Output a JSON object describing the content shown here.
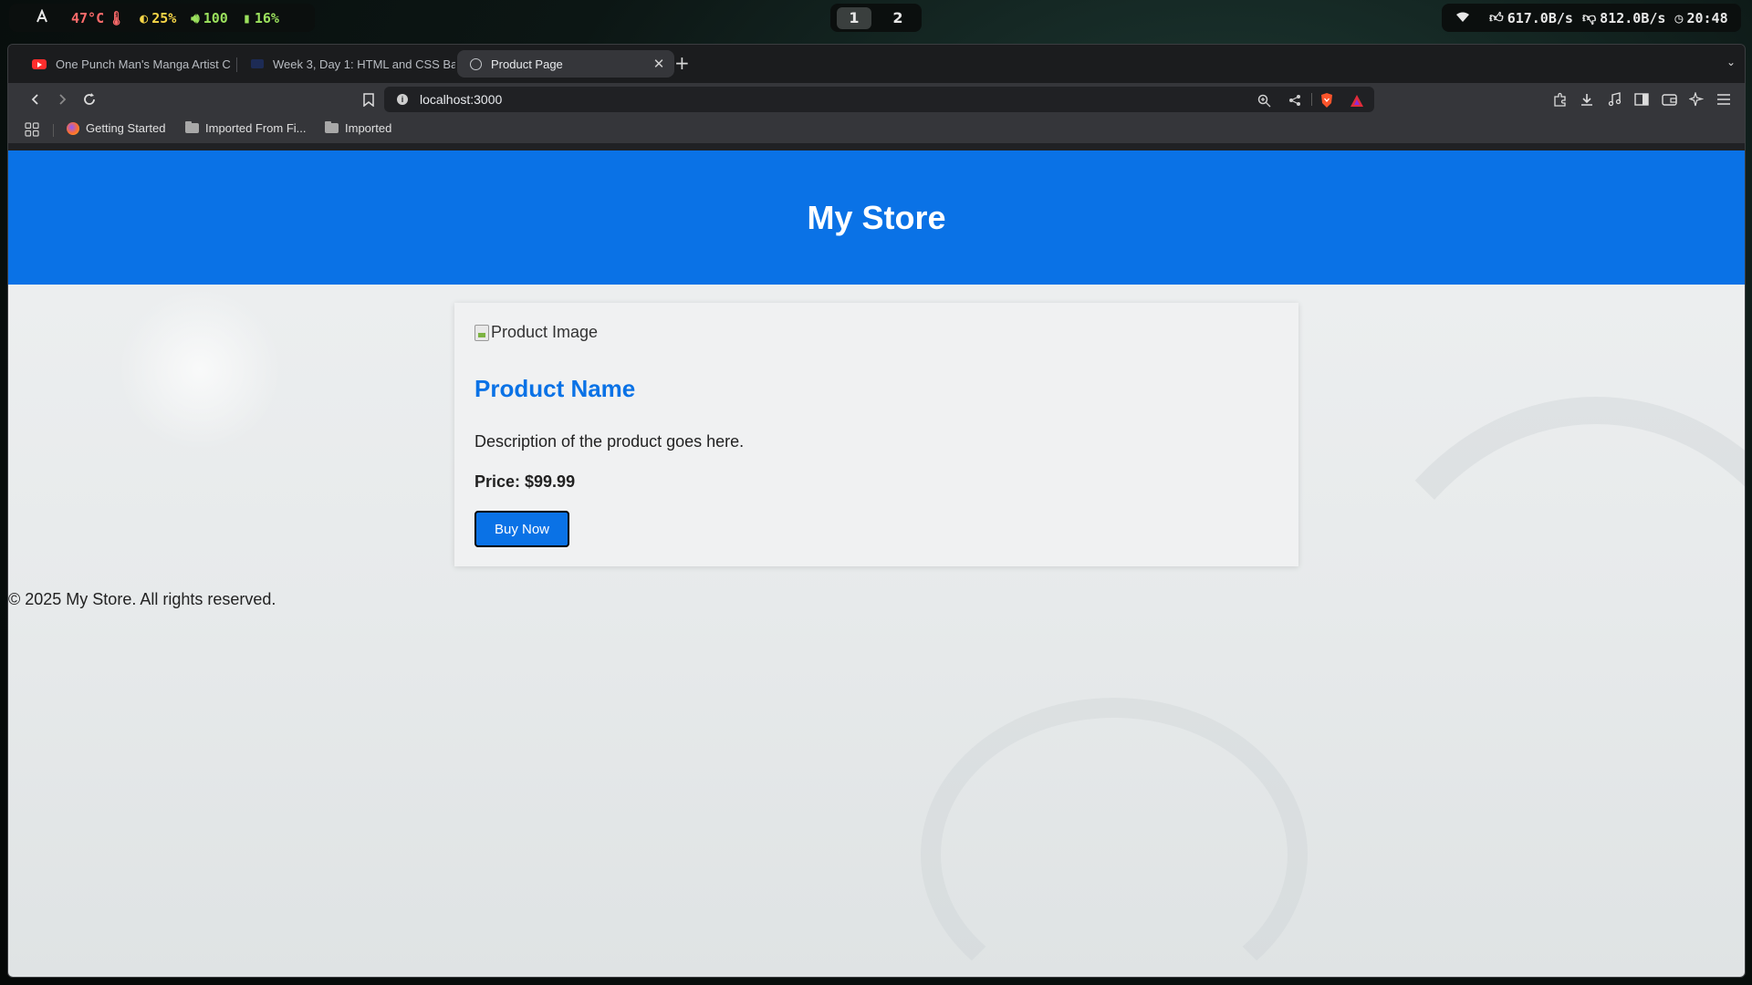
{
  "system_bar": {
    "temperature": "47°C",
    "brightness": "25%",
    "volume": "100",
    "battery": "16%",
    "workspaces": [
      "1",
      "2"
    ],
    "active_workspace": "1",
    "upload_speed": "617.0B/s",
    "download_speed": "812.0B/s",
    "clock": "20:48"
  },
  "browser": {
    "tabs": [
      {
        "title": "One Punch Man's Manga Artist C",
        "favicon": "youtube-icon",
        "active": false
      },
      {
        "title": "Week 3, Day 1: HTML and CSS Ba",
        "favicon": "doc-icon",
        "active": false
      },
      {
        "title": "Product Page",
        "favicon": "globe-icon",
        "active": true
      }
    ],
    "url": "localhost:3000",
    "bookmarks": [
      {
        "label": "Getting Started",
        "icon": "firefox-icon"
      },
      {
        "label": "Imported From Fi...",
        "icon": "folder-icon"
      },
      {
        "label": "Imported",
        "icon": "folder-icon"
      }
    ]
  },
  "page": {
    "header_title": "My Store",
    "product": {
      "image_alt": "Product Image",
      "name": "Product Name",
      "description": "Description of the product goes here.",
      "price": "Price: $99.99",
      "buy_label": "Buy Now"
    },
    "footer": "© 2025 My Store. All rights reserved."
  },
  "colors": {
    "accent": "#0a72e6",
    "page_bg": "#eef0f1"
  }
}
